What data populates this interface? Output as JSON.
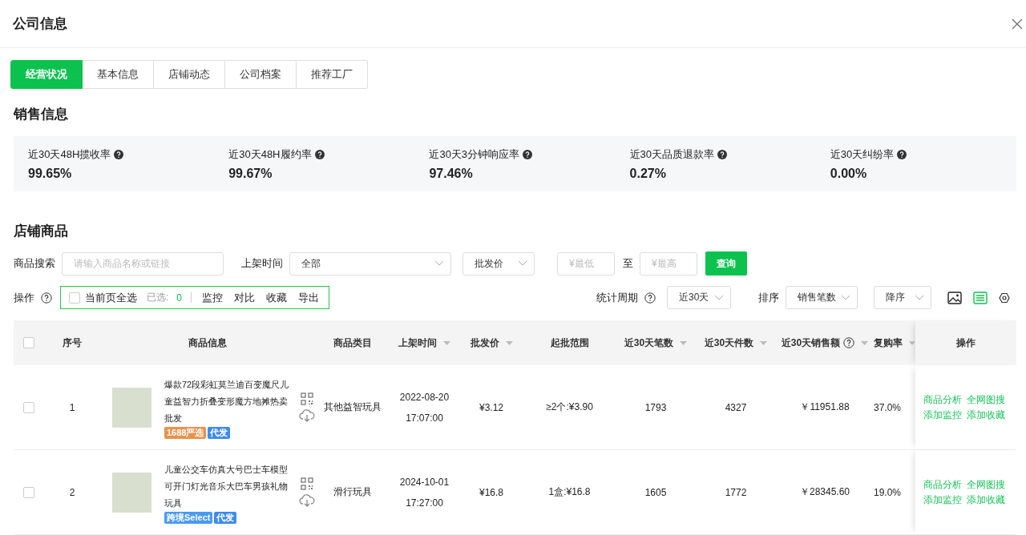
{
  "dialog": {
    "title": "公司信息"
  },
  "tabs": [
    {
      "label": "经营状况",
      "selected": true
    },
    {
      "label": "基本信息",
      "selected": false
    },
    {
      "label": "店铺动态",
      "selected": false
    },
    {
      "label": "公司档案",
      "selected": false
    },
    {
      "label": "推荐工厂",
      "selected": false
    }
  ],
  "sales_section": {
    "title": "销售信息",
    "stats": [
      {
        "label": "近30天48H揽收率",
        "value": "99.65%"
      },
      {
        "label": "近30天48H履约率",
        "value": "99.67%"
      },
      {
        "label": "近30天3分钟响应率",
        "value": "97.46%"
      },
      {
        "label": "近30天品质退款率",
        "value": "0.27%"
      },
      {
        "label": "近30天纠纷率",
        "value": "0.00%"
      }
    ]
  },
  "products_section": {
    "title": "店铺商品",
    "filters": {
      "search_label": "商品搜索",
      "search_placeholder": "请输入商品名称或链接",
      "time_label": "上架时间",
      "time_value": "全部",
      "price_type": "批发价",
      "min_placeholder": "¥最低",
      "range_separator": "至",
      "max_placeholder": "¥最高",
      "query_button": "查询"
    },
    "operations": {
      "label": "操作",
      "select_all": {
        "label": "当前页全选",
        "checked": false
      },
      "selected_label": "已选:",
      "selected_count": "0",
      "actions": [
        "监控",
        "对比",
        "收藏",
        "导出"
      ]
    },
    "period_label": "统计周期",
    "period_value": "近30天",
    "sort_label": "排序",
    "sort_field": "销售笔数",
    "sort_order": "降序",
    "view_modes": [
      {
        "kind": "image",
        "selected": false
      },
      {
        "kind": "list",
        "selected": true
      }
    ],
    "table": {
      "header_checked": false,
      "columns": [
        {
          "label": "序号",
          "sortable": false,
          "help": false
        },
        {
          "label": "商品信息",
          "sortable": false,
          "help": false
        },
        {
          "label": "商品类目",
          "sortable": false,
          "help": false
        },
        {
          "label": "上架时间",
          "sortable": true,
          "help": false
        },
        {
          "label": "批发价",
          "sortable": true,
          "help": false
        },
        {
          "label": "起批范围",
          "sortable": false,
          "help": false
        },
        {
          "label": "近30天笔数",
          "sortable": true,
          "help": false
        },
        {
          "label": "近30天件数",
          "sortable": true,
          "help": false
        },
        {
          "label": "近30天销售额",
          "sortable": true,
          "help": true
        },
        {
          "label": "复购率",
          "sortable": true,
          "help": false
        },
        {
          "label": "操作",
          "sortable": false,
          "help": false
        }
      ],
      "rows": [
        {
          "checked": false,
          "index": "1",
          "title": "爆款72段彩虹莫兰迪百变魔尺儿童益智力折叠变形魔方地摊热卖批发",
          "tags": [
            {
              "label": "1688严选",
              "color": "#e8924a"
            },
            {
              "label": "代发",
              "color": "#3d8bf2"
            }
          ],
          "category": "其他益智玩具",
          "listed": "2022-08-20 17:07:00",
          "price": "¥3.12",
          "moq": "≥2个:¥3.90",
          "orders": "1793",
          "units": "4327",
          "sales": "￥11951.88",
          "repurchase": "37.0%",
          "actions": [
            "商品分析",
            "全网图搜",
            "添加监控",
            "添加收藏"
          ]
        },
        {
          "checked": false,
          "index": "2",
          "title": "儿童公交车仿真大号巴士车模型可开门灯光音乐大巴车男孩礼物玩具",
          "tags": [
            {
              "label": "跨境Select",
              "color": "#4a9af5"
            },
            {
              "label": "代发",
              "color": "#3d8bf2"
            }
          ],
          "category": "滑行玩具",
          "listed": "2024-10-01 17:27:00",
          "price": "¥16.8",
          "moq": "1盒:¥16.8",
          "orders": "1605",
          "units": "1772",
          "sales": "￥28345.60",
          "repurchase": "19.0%",
          "actions": [
            "商品分析",
            "全网图搜",
            "添加监控",
            "添加收藏"
          ]
        }
      ]
    }
  }
}
